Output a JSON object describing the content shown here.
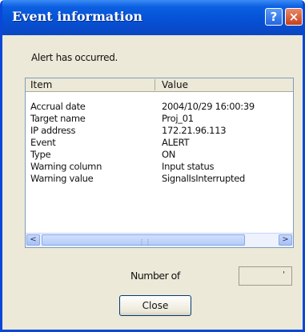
{
  "window": {
    "title": "Event information",
    "help_glyph": "?",
    "close_glyph": "×"
  },
  "message": "Alert has occurred.",
  "list": {
    "columns": [
      "Item",
      "Value"
    ],
    "rows": [
      {
        "item": "Accrual date",
        "value": "2004/10/29 16:00:39"
      },
      {
        "item": "Target name",
        "value": "Proj_01"
      },
      {
        "item": "IP address",
        "value": "172.21.96.113"
      },
      {
        "item": "Event",
        "value": "ALERT"
      },
      {
        "item": "Type",
        "value": "ON"
      },
      {
        "item": "Warning column",
        "value": "Input status"
      },
      {
        "item": "Warning value",
        "value": "SignalIsInterrupted"
      }
    ],
    "scroll_left_glyph": "<",
    "scroll_right_glyph": ">"
  },
  "count": {
    "label": "Number of",
    "value": "'"
  },
  "close_button": "Close"
}
